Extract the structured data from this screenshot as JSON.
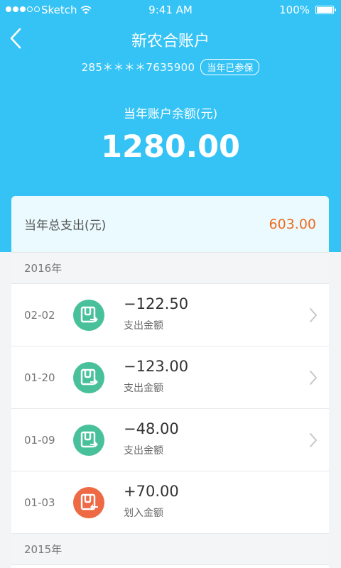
{
  "status": {
    "carrier": "Sketch",
    "time": "9:41 AM",
    "battery": "100%"
  },
  "header": {
    "title": "新农合账户",
    "account_no": "285＊＊＊＊7635900",
    "badge": "当年已参保",
    "balance_label": "当年账户余额(元)",
    "balance": "1280.00"
  },
  "summary": {
    "label": "当年总支出(元)",
    "value": "603.00"
  },
  "groups": [
    {
      "year": "2016年",
      "items": [
        {
          "date": "02-02",
          "amount": "−122.50",
          "type": "支出金额",
          "icon": "wallet-out-icon"
        },
        {
          "date": "01-20",
          "amount": "−123.00",
          "type": "支出金额",
          "icon": "wallet-out-icon"
        },
        {
          "date": "01-09",
          "amount": "−48.00",
          "type": "支出金额",
          "icon": "wallet-out-icon"
        },
        {
          "date": "01-03",
          "amount": "+70.00",
          "type": "划入金额",
          "icon": "wallet-in-icon"
        }
      ]
    },
    {
      "year": "2015年",
      "items": []
    }
  ],
  "colors": {
    "header": "#35c3f6",
    "expense_icon": "#48c19a",
    "income_icon": "#ed6a45",
    "total_value": "#f06a1e"
  }
}
